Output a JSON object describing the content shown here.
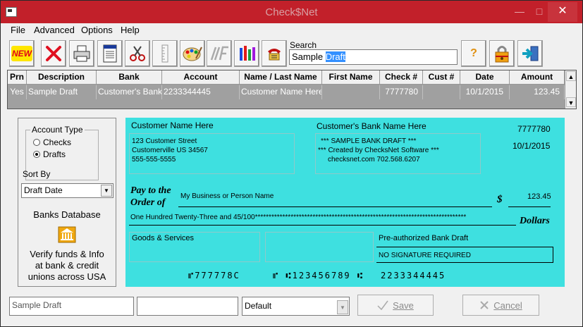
{
  "window": {
    "title": "Check$Net",
    "minimize_glyph": "—",
    "maximize_glyph": "□",
    "close_glyph": "✕"
  },
  "menu": [
    "File",
    "Advanced",
    "Options",
    "Help"
  ],
  "toolbar": {
    "new_label": "NEW",
    "search_label": "Search",
    "search_value": "Sample",
    "search_selected": "Draft",
    "help_glyph": "?"
  },
  "icons": [
    "new-icon",
    "delete-icon",
    "print-icon",
    "report-icon",
    "cut-icon",
    "ruler-icon",
    "palette-icon",
    "font-icon",
    "chart-icon",
    "phone-icon",
    "help-icon",
    "lock-icon",
    "exit-icon"
  ],
  "grid": {
    "headers": [
      "Prn",
      "Description",
      "Bank",
      "Account",
      "Name / Last Name",
      "First Name",
      "Check #",
      "Cust #",
      "Date",
      "Amount"
    ],
    "row": [
      "Yes",
      "Sample Draft",
      "Customer's Bank",
      "2233344445",
      "Customer Name Here",
      "",
      "7777780",
      "",
      "10/1/2015",
      "123.45"
    ]
  },
  "sidebar": {
    "account_type_label": "Account Type",
    "opt_checks": "Checks",
    "opt_drafts": "Drafts",
    "sort_by_label": "Sort By",
    "sort_value": "Draft Date",
    "banks_db_label": "Banks Database",
    "verify_text": [
      "Verify funds & Info",
      "at bank & credit",
      "unions across USA"
    ]
  },
  "check": {
    "customer_name": "Customer Name Here",
    "customer_address": [
      "123 Customer Street",
      "Customerville US 34567",
      "555-555-5555"
    ],
    "bank_name": "Customer's Bank Name Here",
    "bank_info": [
      "*** SAMPLE BANK DRAFT ***",
      "*** Created by ChecksNet Software ***",
      "checksnet.com  702.568.6207"
    ],
    "check_number": "7777780",
    "date": "10/1/2015",
    "pay_to_label_1": "Pay to the",
    "pay_to_label_2": "Order of",
    "payee": "My Business or Person Name",
    "dollar_sign": "$",
    "amount": "123.45",
    "amount_words": "One Hundred Twenty-Three and 45/100*****************************************************************************",
    "dollars_label": "Dollars",
    "memo": "Goods & Services",
    "preauth": "Pre-authorized Bank Draft",
    "no_signature": "NO SIGNATURE REQUIRED",
    "micr_check": "⑈777778C",
    "micr_routing": "⑈ ⑆123456789 ⑆",
    "micr_account": "2233344445"
  },
  "bottom": {
    "description_value": "Sample Draft",
    "second_value": "",
    "combo_value": "Default",
    "save_label": "Save",
    "cancel_label": "Cancel"
  },
  "colors": {
    "check_bg": "#3ee0e0",
    "titlebar": "#c2202a",
    "grid_row": "#a0a0a0"
  }
}
